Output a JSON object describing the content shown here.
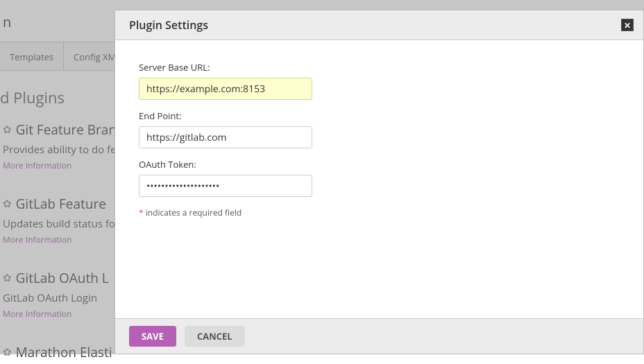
{
  "bg": {
    "header": "n",
    "tabs": [
      "Templates",
      "Config XM"
    ],
    "section_title": "d Plugins",
    "plugins": [
      {
        "title": "Git Feature Branch",
        "desc": "Provides ability to do fea",
        "more": "More Information"
      },
      {
        "title": "GitLab Feature",
        "desc": "Updates build status for",
        "more": "More Information"
      },
      {
        "title": "GitLab OAuth L",
        "desc": "GitLab OAuth Login",
        "more": "More Information"
      },
      {
        "title": "Marathon Elasti",
        "desc": "",
        "more": ""
      }
    ]
  },
  "modal": {
    "title": "Plugin Settings",
    "fields": {
      "server_base_url": {
        "label": "Server Base URL:",
        "value": "https://example.com:8153"
      },
      "endpoint": {
        "label": "End Point:",
        "value": "https://gitlab.com"
      },
      "oauth_token": {
        "label": "OAuth Token:",
        "value": "••••••••••••••••••••"
      }
    },
    "required_star": "*",
    "required_text": " indicates a required field",
    "buttons": {
      "save": "SAVE",
      "cancel": "CANCEL"
    }
  }
}
